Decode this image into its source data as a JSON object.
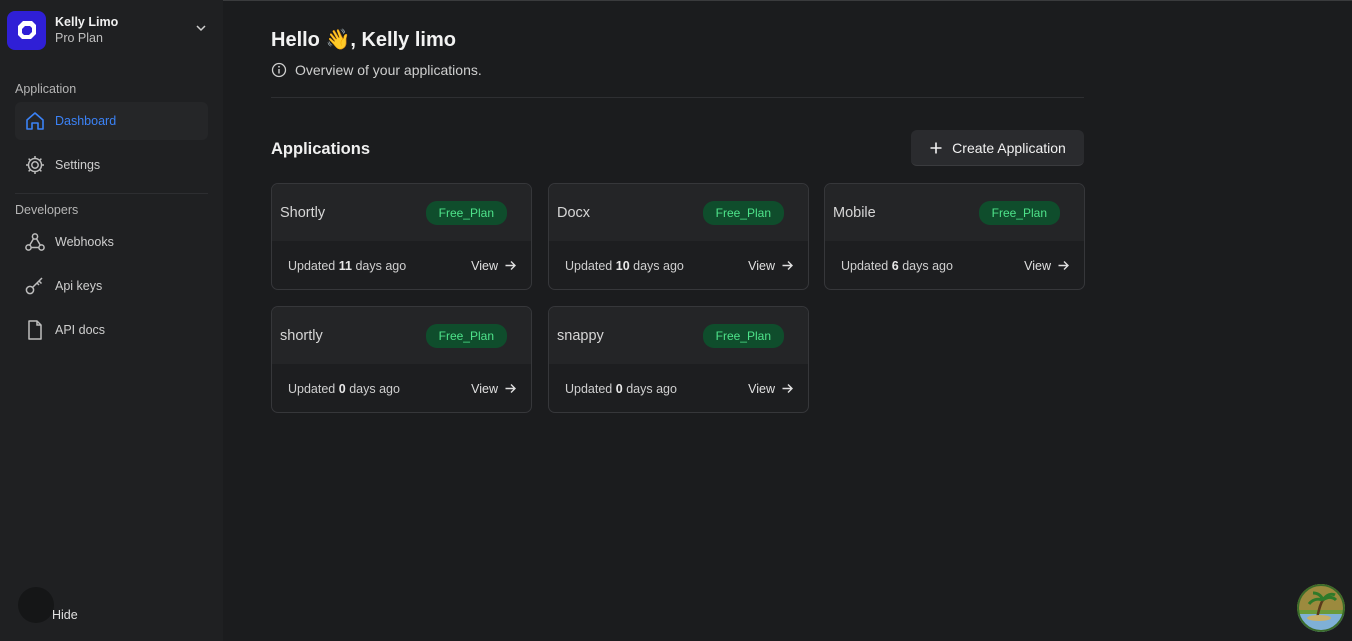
{
  "account": {
    "name": "Kelly Limo",
    "plan": "Pro Plan"
  },
  "sidebar": {
    "application_label": "Application",
    "developers_label": "Developers",
    "items": [
      {
        "label": "Dashboard",
        "icon": "home-icon"
      },
      {
        "label": "Settings",
        "icon": "gear-icon"
      },
      {
        "label": "Webhooks",
        "icon": "webhook-icon"
      },
      {
        "label": "Api keys",
        "icon": "key-icon"
      },
      {
        "label": "API docs",
        "icon": "document-icon"
      }
    ],
    "hide_label": "Hide"
  },
  "header": {
    "greeting_prefix": "Hello",
    "greeting_emoji": "👋",
    "greeting_name": ", Kelly limo",
    "subtitle": "Overview of your applications."
  },
  "applications": {
    "title": "Applications",
    "create_label": "Create Application",
    "updated_prefix": "Updated",
    "days_suffix": "days ago",
    "view_label": "View",
    "cards": [
      {
        "name": "Shortly",
        "plan": "Free_Plan",
        "days": "11"
      },
      {
        "name": "Docx",
        "plan": "Free_Plan",
        "days": "10"
      },
      {
        "name": "Mobile",
        "plan": "Free_Plan",
        "days": "6"
      },
      {
        "name": "shortly",
        "plan": "Free_Plan",
        "days": "0"
      },
      {
        "name": "snappy",
        "plan": "Free_Plan",
        "days": "0"
      }
    ]
  },
  "colors": {
    "accent": "#3b82f6",
    "badge_bg": "#0f4d2c",
    "badge_text": "#4ee38a",
    "logo": "#2f1fd6"
  }
}
